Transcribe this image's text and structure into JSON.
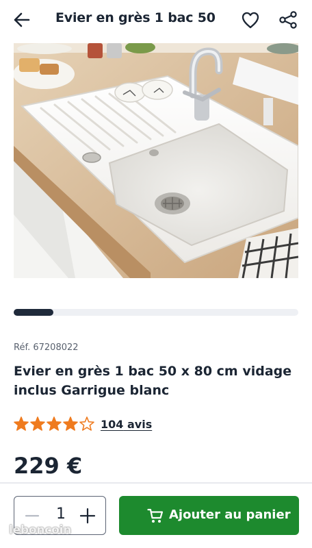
{
  "header": {
    "title": "Evier en grès 1 bac 50 ...",
    "icons": [
      "back-arrow-icon",
      "heart-icon",
      "share-icon"
    ]
  },
  "gallery": {
    "image_description": "white ceramic kitchen sink with drainboard and chrome faucet on wooden countertop",
    "progress": 0.14
  },
  "product": {
    "ref_label": "Réf.",
    "ref_value": "67208022",
    "title": "Evier en grès 1 bac 50 x 80 cm vidage inclus Garrigue blanc",
    "rating": 4,
    "rating_max": 5,
    "reviews_count": "104",
    "reviews_label": "avis",
    "price": "229 €"
  },
  "purchase": {
    "quantity": "1",
    "add_to_cart_label": "Ajouter au panier"
  },
  "watermark": "leboncoin",
  "colors": {
    "star": "#ef7b1f",
    "accent_green": "#1d8a2e",
    "text_dark": "#1b2533",
    "progress_fill": "#1f2a3b"
  }
}
